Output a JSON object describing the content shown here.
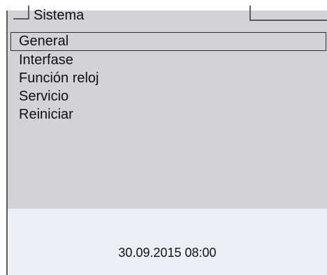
{
  "header": {
    "title": "Sistema"
  },
  "menu": {
    "items": [
      {
        "label": "General",
        "selected": true
      },
      {
        "label": "Interfase",
        "selected": false
      },
      {
        "label": "Función reloj",
        "selected": false
      },
      {
        "label": "Servicio",
        "selected": false
      },
      {
        "label": "Reiniciar",
        "selected": false
      }
    ]
  },
  "status": {
    "datetime": "30.09.2015 08:00"
  },
  "colors": {
    "screen_background": "#d3d2d4",
    "status_background": "#eceff6",
    "frame": "#5c5c5c"
  }
}
